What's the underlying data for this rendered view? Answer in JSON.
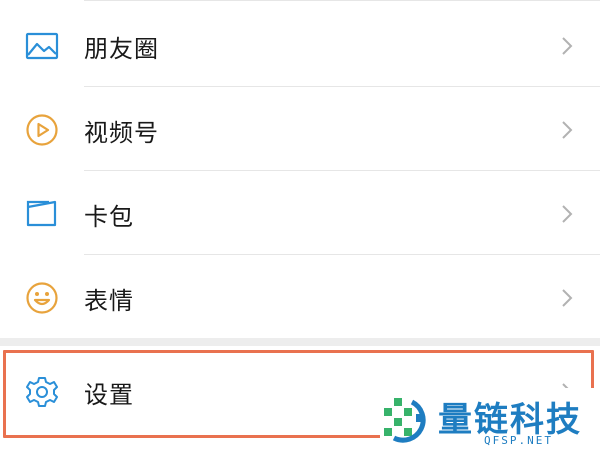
{
  "menu": {
    "items": [
      {
        "label": "朋友圈",
        "icon": "moments-image-icon",
        "color": "#2a8fd8"
      },
      {
        "label": "视频号",
        "icon": "channels-play-icon",
        "color": "#e8a33c"
      },
      {
        "label": "卡包",
        "icon": "card-wallet-icon",
        "color": "#2a8fd8"
      },
      {
        "label": "表情",
        "icon": "sticker-smile-icon",
        "color": "#e8a33c"
      }
    ],
    "settings": {
      "label": "设置",
      "icon": "gear-icon",
      "color": "#2a8fd8"
    }
  },
  "highlight_color": "#e9714f",
  "watermark": {
    "title": "量链科技",
    "subtitle": "QFSP.NET"
  }
}
